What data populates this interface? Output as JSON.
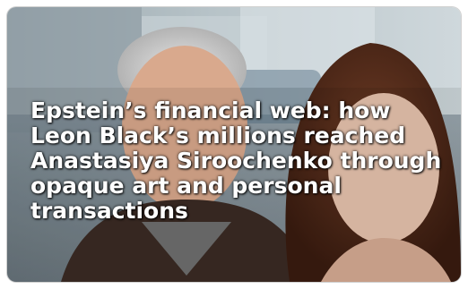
{
  "article": {
    "headline": "Epstein’s financial web: how Leon Black’s millions reached Anastasiya Siroochenko through opaque art and personal transactions"
  },
  "colors": {
    "headline_text": "#ffffff",
    "background": "#ffffff"
  }
}
